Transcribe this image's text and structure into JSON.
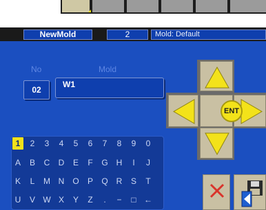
{
  "header": {
    "program_name": "NewMold",
    "program_number": "2",
    "mold_status": "Mold: Default"
  },
  "form": {
    "no_label": "No",
    "mold_label": "Mold",
    "no_value": "02",
    "mold_value": "W1"
  },
  "keypad": {
    "rows": [
      [
        "1",
        "2",
        "3",
        "4",
        "5",
        "6",
        "7",
        "8",
        "9",
        "0"
      ],
      [
        "A",
        "B",
        "C",
        "D",
        "E",
        "F",
        "G",
        "H",
        "I",
        "J"
      ],
      [
        "K",
        "L",
        "M",
        "N",
        "O",
        "P",
        "Q",
        "R",
        "S",
        "T"
      ],
      [
        "U",
        "V",
        "W",
        "X",
        "Y",
        "Z",
        ".",
        "−",
        "□",
        "←"
      ]
    ],
    "selected": "1"
  },
  "dpad": {
    "ent_label": "ENT",
    "up_icon": "arrow-up-icon",
    "down_icon": "arrow-down-icon",
    "left_icon": "arrow-left-icon",
    "right_icon": "arrow-right-icon"
  },
  "actions": {
    "cancel_icon": "close-icon",
    "save_icon": "save-icon"
  },
  "colors": {
    "panel": "#1b4fc0",
    "field": "#0f3fae",
    "accent": "#f3e21a",
    "button_face": "#c9c0a3",
    "cancel": "#d9342b"
  }
}
